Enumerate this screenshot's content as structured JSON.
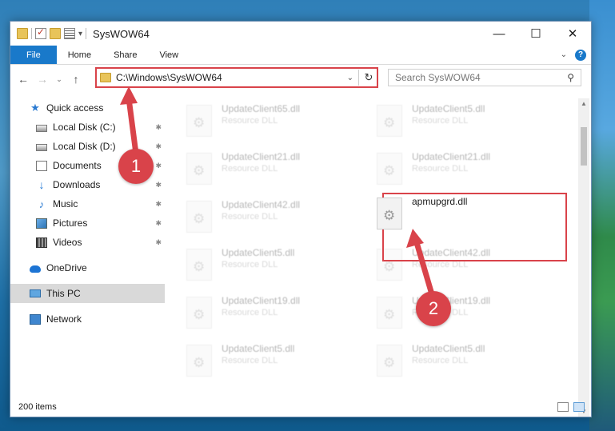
{
  "window": {
    "title": "SysWOW64",
    "controls": {
      "minimize": "—",
      "maximize": "☐",
      "close": "✕"
    }
  },
  "ribbon": {
    "tabs": [
      "File",
      "Home",
      "Share",
      "View"
    ],
    "help": "?"
  },
  "navigation": {
    "back": "←",
    "forward": "→",
    "recent": "⌄",
    "up": "↑",
    "address_path": "C:\\Windows\\SysWOW64",
    "refresh": "↻",
    "dropdown": "⌄"
  },
  "search": {
    "placeholder": "Search SysWOW64",
    "icon": "⚲"
  },
  "sidebar": {
    "quick_access": "Quick access",
    "items": [
      {
        "label": "Local Disk (C:)",
        "icon": "drive-icon",
        "pinned": true
      },
      {
        "label": "Local Disk (D:)",
        "icon": "drive-icon",
        "pinned": true
      },
      {
        "label": "Documents",
        "icon": "documents-icon",
        "pinned": true
      },
      {
        "label": "Downloads",
        "icon": "downloads-icon",
        "pinned": true
      },
      {
        "label": "Music",
        "icon": "music-icon",
        "pinned": true
      },
      {
        "label": "Pictures",
        "icon": "pictures-icon",
        "pinned": true
      },
      {
        "label": "Videos",
        "icon": "videos-icon",
        "pinned": true
      }
    ],
    "onedrive": "OneDrive",
    "this_pc": "This PC",
    "network": "Network",
    "pin_glyph": "📌"
  },
  "files": {
    "left_column": [
      {
        "name": "UpdateClient65.dll",
        "type": "Resource DLL"
      },
      {
        "name": "UpdateClient21.dll",
        "type": "Resource DLL"
      },
      {
        "name": "UpdateClient42.dll",
        "type": "Resource DLL"
      },
      {
        "name": "UpdateClient5.dll",
        "type": "Resource DLL"
      },
      {
        "name": "UpdateClient19.dll",
        "type": "Resource DLL"
      },
      {
        "name": "UpdateClient5.dll",
        "type": "Resource DLL"
      }
    ],
    "right_column": [
      {
        "name": "UpdateClient5.dll",
        "type": "Resource DLL"
      },
      {
        "name": "UpdateClient21.dll",
        "type": "Resource DLL"
      },
      {
        "name": "UpdateClient42.dll",
        "type": "Resource DLL"
      },
      {
        "name": "UpdateClient19.dll",
        "type": "Resource DLL"
      },
      {
        "name": "UpdateClient5.dll",
        "type": "Resource DLL"
      }
    ],
    "highlighted": {
      "name": "apmupgrd.dll"
    }
  },
  "status": {
    "item_count": "200 items"
  },
  "callouts": {
    "first": "1",
    "second": "2"
  },
  "colors": {
    "accent": "#1979ca",
    "highlight": "#d9434a"
  }
}
